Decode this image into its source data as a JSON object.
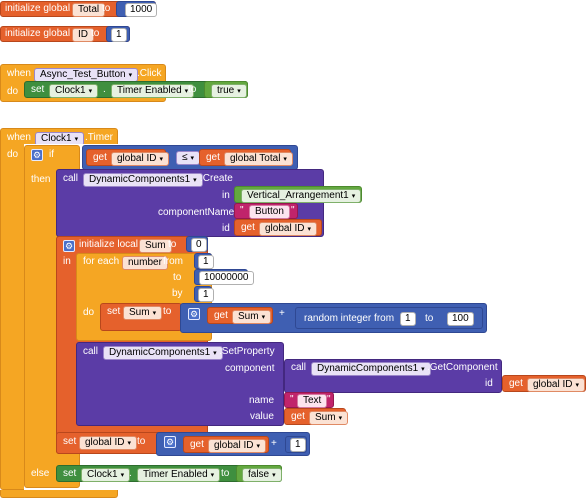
{
  "blocks": {
    "init_total": {
      "keyword": "initialize global",
      "name": "Total",
      "to": "to",
      "value": "1000"
    },
    "init_id": {
      "keyword": "initialize global",
      "name": "ID",
      "to": "to",
      "value": "1"
    },
    "when_button": {
      "when": "when",
      "component": "Async_Test_Button",
      "event": ".Click",
      "do": "do",
      "set": "set",
      "target": "Clock1",
      "property": "Timer Enabled",
      "to": "to",
      "value": "true"
    },
    "when_clock": {
      "when": "when",
      "component": "Clock1",
      "event": ".Timer",
      "do": "do",
      "if": "if",
      "then": "then",
      "else": "else",
      "cond_left_get": "get",
      "cond_left_var": "global ID",
      "operator": "≤",
      "cond_right_get": "get",
      "cond_right_var": "global Total",
      "create_call": "call",
      "create_comp": "DynamicComponents1",
      "create_method": ".Create",
      "in_label": "in",
      "in_value": "Vertical_Arrangement1",
      "cn_label": "componentName",
      "cn_value": "Button",
      "id_label": "id",
      "id_get": "get",
      "id_var": "global ID",
      "local_label": "initialize local",
      "local_name": "Sum",
      "local_to": "to",
      "local_value": "0",
      "local_in": "in",
      "foreach_label": "for each",
      "foreach_var": "number",
      "foreach_from": "from",
      "from_value": "1",
      "foreach_to": "to",
      "to_value": "10000000",
      "foreach_by": "by",
      "by_value": "1",
      "foreach_do": "do",
      "sum_set": "set",
      "sum_var": "Sum",
      "sum_to": "to",
      "sum_get": "get",
      "sum_get_var": "Sum",
      "plus": "+",
      "random_label": "random integer from",
      "random_from": "1",
      "random_to_label": "to",
      "random_to": "100",
      "sp_call": "call",
      "sp_comp": "DynamicComponents1",
      "sp_method": ".SetProperty",
      "sp_component_label": "component",
      "gc_call": "call",
      "gc_comp": "DynamicComponents1",
      "gc_method": ".GetComponent",
      "gc_id_label": "id",
      "gc_id_get": "get",
      "gc_id_var": "global ID",
      "sp_name_label": "name",
      "sp_name_value": "Text",
      "sp_value_label": "value",
      "sp_value_get": "get",
      "sp_value_var": "Sum",
      "setid_set": "set",
      "setid_var": "global ID",
      "setid_to": "to",
      "setid_get": "get",
      "setid_get_var": "global ID",
      "setid_plus": "+",
      "setid_num": "1",
      "else_set": "set",
      "else_target": "Clock1",
      "else_property": "Timer Enabled",
      "else_to": "to",
      "else_value": "false"
    }
  },
  "colors": {
    "variable": "#e5612c",
    "control": "#f5a623",
    "component": "#5b3ca6",
    "setter": "#3f8f3f",
    "math": "#3f5fb2",
    "logic": "#63a83f",
    "text": "#c0246b"
  }
}
